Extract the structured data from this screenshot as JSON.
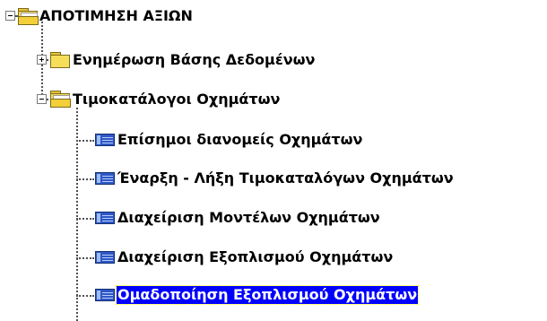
{
  "tree": {
    "root": {
      "label": "ΑΠΟΤΙΜΗΣΗ ΑΞΙΩΝ",
      "expanded": true
    },
    "children": [
      {
        "label": "Ενημέρωση Βάσης Δεδομένων",
        "type": "folder",
        "expanded": false
      },
      {
        "label": "Τιμοκατάλογοι Οχημάτων",
        "type": "folder",
        "expanded": true,
        "items": [
          {
            "label": "Επίσημοι διανομείς Οχημάτων",
            "selected": false
          },
          {
            "label": "Έναρξη - Λήξη Τιμοκαταλόγων Οχημάτων",
            "selected": false
          },
          {
            "label": "Διαχείριση Μοντέλων Οχημάτων",
            "selected": false
          },
          {
            "label": "Διαχείριση Εξοπλισμού Οχημάτων",
            "selected": false
          },
          {
            "label": "Ομαδοποίηση Εξοπλισμού Οχημάτων",
            "selected": true
          }
        ]
      }
    ]
  },
  "colors": {
    "selection_background": "#0000ff",
    "selection_text": "#ffffff",
    "folder": "#f7de5a",
    "page_icon": "#2e57c7"
  }
}
